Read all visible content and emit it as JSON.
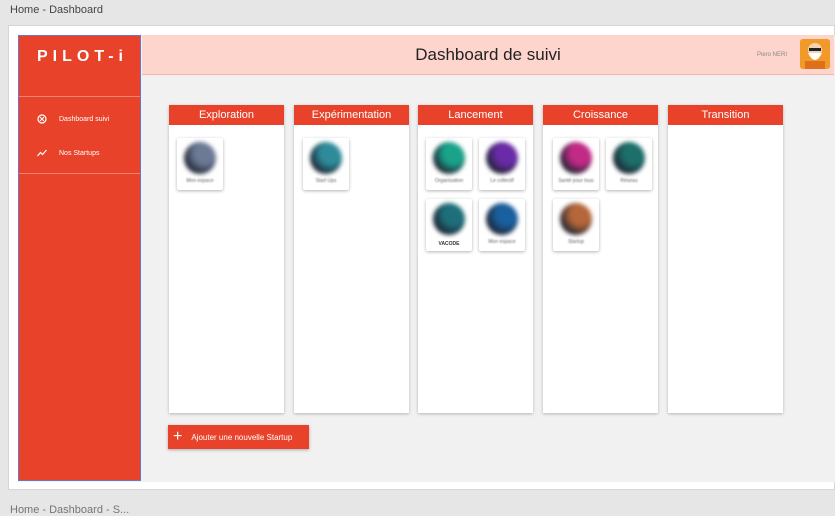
{
  "window": {
    "breadcrumb": "Home - Dashboard",
    "bottom_breadcrumb": "Home - Dashboard - S..."
  },
  "sidebar": {
    "logo": "PILOT-i",
    "items": [
      {
        "label": "Dashboard suivi",
        "icon": "target-icon"
      },
      {
        "label": "Nos Startups",
        "icon": "trend-up-icon"
      }
    ]
  },
  "header": {
    "title": "Dashboard de suivi",
    "user_name": "Piero NERI"
  },
  "board": {
    "columns": [
      {
        "title": "Exploration"
      },
      {
        "title": "Expérimentation"
      },
      {
        "title": "Lancement"
      },
      {
        "title": "Croissance"
      },
      {
        "title": "Transition"
      }
    ],
    "add_button_label": "Ajouter une nouvelle Startup",
    "cards": [
      {
        "column": 0,
        "caption": "Mon espace",
        "color": "#6c7a96"
      },
      {
        "column": 1,
        "caption": "Start Ups",
        "color": "#2e8c9a"
      },
      {
        "column": 2,
        "caption": "Organisation",
        "color": "#1aa38a"
      },
      {
        "column": 2,
        "caption": "Le collectif",
        "color": "#6a2ba8"
      },
      {
        "column": 2,
        "caption": "VACODE",
        "color": "#1d6f7a"
      },
      {
        "column": 2,
        "caption": "Mon espace",
        "color": "#1a5f9e"
      },
      {
        "column": 3,
        "caption": "Santé pour tous",
        "color": "#c22a86"
      },
      {
        "column": 3,
        "caption": "Réseau",
        "color": "#1c6f6a"
      },
      {
        "column": 3,
        "caption": "Startup",
        "color": "#b5663a"
      }
    ]
  },
  "colors": {
    "accent": "#e8432a",
    "header_bg": "#fdd5cd"
  }
}
